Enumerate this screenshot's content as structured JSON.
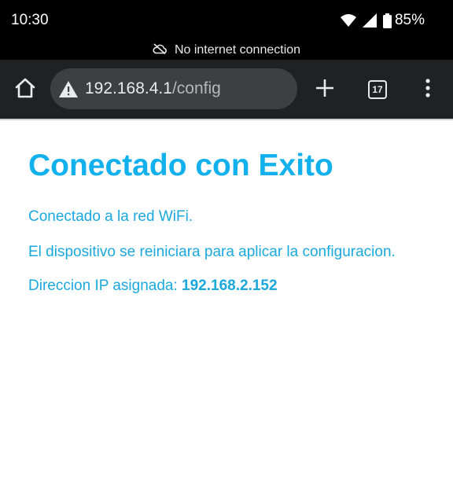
{
  "status_bar": {
    "time": "10:30",
    "battery": "85%",
    "icons": [
      "wifi-icon",
      "signal-icon",
      "battery-icon"
    ]
  },
  "offline_banner": {
    "icon": "cloud-off-icon",
    "text": "No internet connection"
  },
  "toolbar": {
    "home_icon": "home-icon",
    "url_warning_icon": "warning-icon",
    "url_host": "192.168.4.1",
    "url_path": "/config",
    "new_tab_icon": "plus-icon",
    "tab_count": "17",
    "menu_icon": "more-vert-icon"
  },
  "page": {
    "heading": "Conectado con Exito",
    "line1": "Conectado a la red WiFi.",
    "line2": "El dispositivo se reiniciara para aplicar la configuracion.",
    "ip_label": "Direccion IP asignada: ",
    "ip_value": "192.168.2.152"
  },
  "colors": {
    "accent": "#12b0ec",
    "toolbar_bg": "#202124",
    "omnibox_bg": "#3c4043"
  }
}
